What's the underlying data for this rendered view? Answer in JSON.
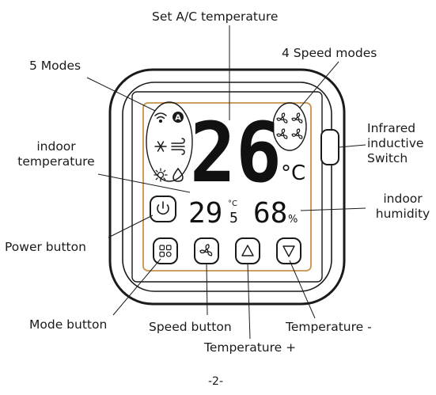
{
  "labels": {
    "set_temp": "Set A/C temperature",
    "modes": "5 Modes",
    "speed_modes": "4 Speed modes",
    "indoor_temp": "indoor\ntemperature",
    "infrared": "Infrared\ninductive\nSwitch",
    "humidity": "indoor\nhumidity",
    "power_button": "Power button",
    "mode_button": "Mode button",
    "speed_button": "Speed button",
    "temp_minus": "Temperature -",
    "temp_plus": "Temperature +"
  },
  "display": {
    "set_temperature": "26",
    "set_unit": "°C",
    "indoor_temp_int": "29",
    "indoor_temp_dec": "5",
    "indoor_temp_unit": "°C",
    "humidity_value": "68",
    "humidity_unit": "%"
  },
  "page_number": "-2-",
  "colors": {
    "frame": "#1a1a1a",
    "panel_border": "#c8924a",
    "display": "#111111"
  },
  "icons": [
    "wifi-icon",
    "auto-mode-icon",
    "cool-mode-icon",
    "fan-mode-icon",
    "heat-mode-icon",
    "dry-mode-icon",
    "fan-speed-icon",
    "power-icon",
    "mode-icon",
    "speed-icon",
    "temp-up-icon",
    "temp-down-icon"
  ]
}
